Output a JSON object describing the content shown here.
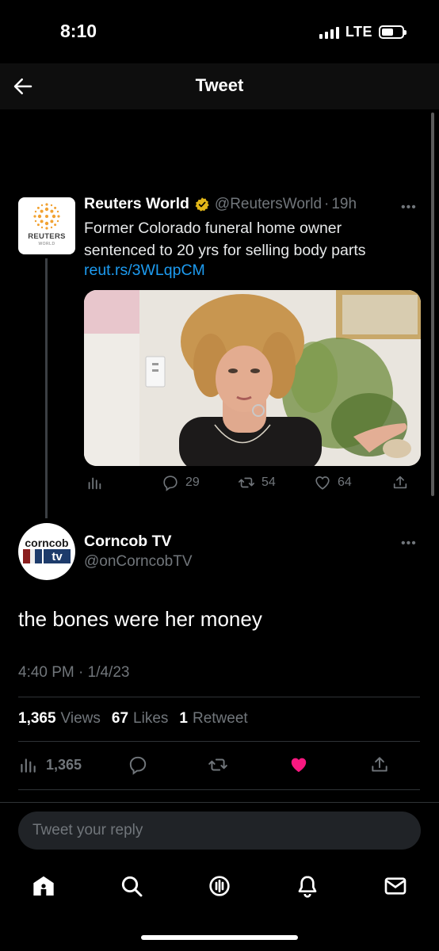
{
  "status_bar": {
    "time": "8:10",
    "network": "LTE"
  },
  "nav": {
    "title": "Tweet",
    "back_icon": "arrow-left-icon"
  },
  "quoted_tweet": {
    "author_name": "Reuters World",
    "handle": "@ReutersWorld",
    "separator": "·",
    "age": "19h",
    "text": "Former Colorado funeral home owner sentenced to 20 yrs for selling body parts",
    "link": "reut.rs/3WLqpCM",
    "avatar_logo_text": "REUTERS",
    "avatar_logo_subtext": "WORLD",
    "actions": {
      "replies": "29",
      "retweets": "54",
      "likes": "64"
    }
  },
  "tweet": {
    "author_name": "Corncob TV",
    "handle": "@onCorncobTV",
    "avatar_logo_top": "corncob",
    "avatar_logo_bottom": "tv",
    "text": "the bones were her money",
    "timestamp": "4:40 PM · 1/4/23",
    "stats": {
      "views_count": "1,365",
      "views_label": "Views",
      "likes_count": "67",
      "likes_label": "Likes",
      "retweets_count": "1",
      "retweets_label": "Retweet"
    },
    "actions": {
      "views": "1,365",
      "liked": true
    }
  },
  "reply": {
    "placeholder": "Tweet your reply"
  },
  "colors": {
    "accent": "#1d9bf0",
    "like": "#f91880",
    "verified_gold": "#e2b719",
    "muted": "#71767b"
  },
  "bottom_nav": [
    "home-icon",
    "search-icon",
    "spaces-icon",
    "notifications-icon",
    "messages-icon"
  ]
}
